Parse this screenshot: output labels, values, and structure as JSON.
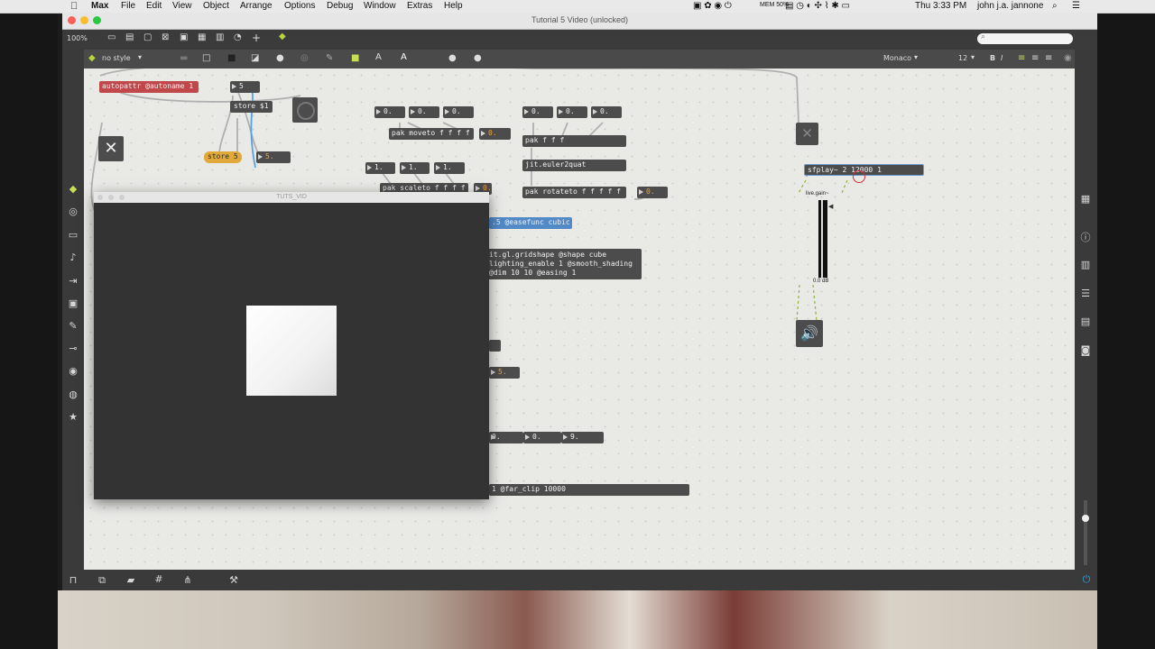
{
  "menubar": {
    "app": "Max",
    "items": [
      "File",
      "Edit",
      "View",
      "Object",
      "Arrange",
      "Options",
      "Debug",
      "Window",
      "Extras",
      "Help"
    ],
    "battery": "MEM 50%",
    "clock": "Thu 3:33 PM",
    "user": "john j.a. jannone"
  },
  "window": {
    "title": "Tutorial 5 Video (unlocked)"
  },
  "toolbar": {
    "zoom": "100%"
  },
  "toolbar2": {
    "style": "no style",
    "font": "Monaco",
    "size": "12",
    "bold": "B",
    "italic": "I",
    "text_a": "A",
    "text_a2": "A"
  },
  "objects": {
    "autopattr": "autopattr @autoname 1",
    "num5": "5",
    "store1": "store $1",
    "store5": "store 5",
    "num5b": "5.",
    "n0a": "0.",
    "n0b": "0.",
    "n0c": "0.",
    "pakmoveto": "pak moveto f f f f",
    "n0d": "0.",
    "n1a": "1.",
    "n1b": "1.",
    "n1c": "1.",
    "pakscaleto": "pak scaleto f f f f",
    "n0e": "0.",
    "n0f": "0.",
    "n0g": "0.",
    "n0h": "0.",
    "pakfff": "pak f f f",
    "euler": "jit.euler2quat",
    "pakrotateto": "pak rotateto f f f f f",
    "n0i": "0.",
    "easefunc": ".5 @easefunc cubic",
    "gridshape1": "it.gl.gridshape @shape cube",
    "gridshape2": "lighting_enable 1 @smooth_shading",
    "gridshape3": "@dim 10 10 @easing 1",
    "n5c": "5.",
    "n0j": "0.",
    "n0k": "0.",
    "n9": "9.",
    "farclip": "1 @far_clip 10000",
    "sfplay": "sfplay~ 2 12000 1",
    "livegain": "live.gain~",
    "db": "0.0 dB"
  },
  "video_window": {
    "title": "TUTS_VID"
  }
}
